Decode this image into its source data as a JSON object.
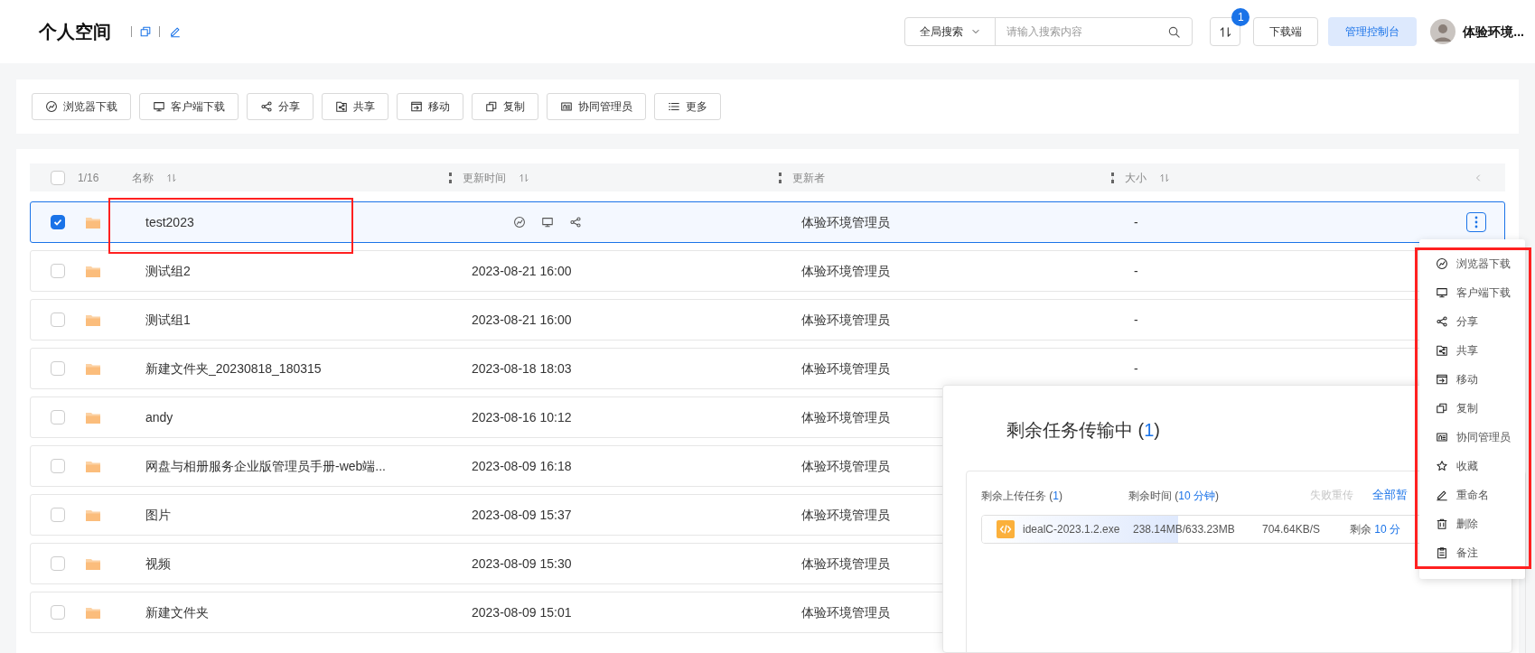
{
  "header": {
    "title": "个人空间",
    "search_scope": "全局搜索",
    "search": {
      "placeholder": "请输入搜索内容"
    },
    "notification_count": "1",
    "download_button": "下载端",
    "admin_button": "管理控制台",
    "user_name": "体验环境..."
  },
  "toolbar": [
    "浏览器下载",
    "客户端下载",
    "分享",
    "共享",
    "移动",
    "复制",
    "协同管理员",
    "更多"
  ],
  "table": {
    "select_all": false,
    "selection_count": "1/16",
    "columns": [
      "名称",
      "更新时间",
      "更新者",
      "大小"
    ],
    "rows": [
      {
        "name": "test2023",
        "updater": "体验环境管理员",
        "size": "-",
        "checked": true
      },
      {
        "name": "测试组2",
        "updated": "2023-08-21 16:00",
        "updater": "体验环境管理员",
        "size": "-",
        "checked": false
      },
      {
        "name": "测试组1",
        "updated": "2023-08-21 16:00",
        "updater": "体验环境管理员",
        "size": "-",
        "checked": false
      },
      {
        "name": "新建文件夹_20230818_180315",
        "updated": "2023-08-18 18:03",
        "updater": "体验环境管理员",
        "size": "-",
        "checked": false
      },
      {
        "name": "andy",
        "updated": "2023-08-16 10:12",
        "updater": "体验环境管理员",
        "checked": false
      },
      {
        "name": "网盘与相册服务企业版管理员手册-web端...",
        "updated": "2023-08-09 16:18",
        "updater": "体验环境管理员",
        "checked": false
      },
      {
        "name": "图片",
        "updated": "2023-08-09 15:37",
        "updater": "体验环境管理员",
        "checked": false
      },
      {
        "name": "视频",
        "updated": "2023-08-09 15:30",
        "updater": "体验环境管理员",
        "checked": false
      },
      {
        "name": "新建文件夹",
        "updated": "2023-08-09 15:01",
        "updater": "体验环境管理员",
        "checked": false
      }
    ]
  },
  "context_menu": {
    "items": [
      "浏览器下载",
      "客户端下载",
      "分享",
      "共享",
      "移动",
      "复制",
      "协同管理员",
      "收藏",
      "重命名",
      "删除",
      "备注"
    ]
  },
  "transfer_panel": {
    "title": [
      {
        "text": "剩余任务传输中 (",
        "accent": false
      },
      {
        "text": "1",
        "accent": true
      },
      {
        "text": ")",
        "accent": false
      }
    ],
    "upload_tasks": [
      {
        "text": "剩余上传任务 (",
        "accent": false
      },
      {
        "text": "1",
        "accent": true
      },
      {
        "text": ")",
        "accent": false
      }
    ],
    "time_left": [
      {
        "text": "剩余时间 (",
        "accent": false
      },
      {
        "text": "10 分钟",
        "accent": true
      },
      {
        "text": ")",
        "accent": false
      }
    ],
    "retry": {
      "label": "失败重传",
      "disabled": true
    },
    "pause_all": "全部暂",
    "tasks": [
      {
        "name": "idealC-2023.1.2.exe",
        "size": "238.14MB/633.23MB",
        "speed": "704.64KB/S",
        "remaining": [
          {
            "text": "剩余 ",
            "accent": false
          },
          {
            "text": "10 分",
            "accent": true
          }
        ],
        "level": 0.376
      }
    ]
  }
}
